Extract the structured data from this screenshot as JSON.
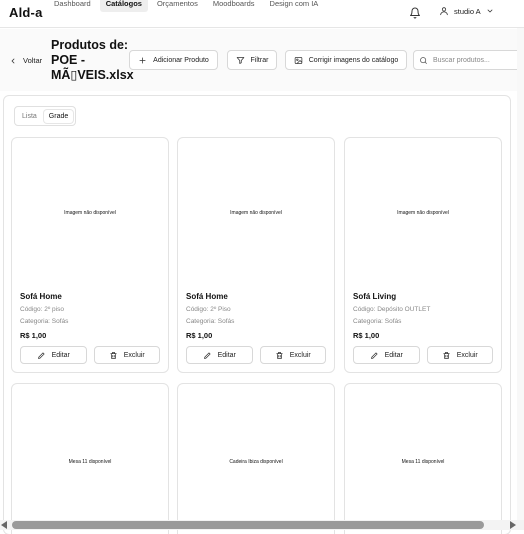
{
  "app": {
    "brand": "Ald-a"
  },
  "nav": {
    "links": [
      "Dashboard",
      "Catálogos",
      "Orçamentos",
      "Moodboards",
      "Design com IA"
    ],
    "active_index": 1
  },
  "user": {
    "name": "studio A"
  },
  "toolbar": {
    "back_label": "Voltar",
    "title": "Produtos de: POE - MÃ▯VEIS.xlsx",
    "add_label": "Adicionar Produto",
    "filter_label": "Filtrar",
    "fix_images_label": "Corrigir imagens do catálogo",
    "search_placeholder": "Buscar produtos..."
  },
  "view_toggle": {
    "options": [
      "Lista",
      "Grade"
    ],
    "active": "Grade"
  },
  "products": [
    {
      "image_text": "Imagem não disponível",
      "name": "Sofá Home",
      "code": "Código: 2º piso",
      "category": "Categoria: Sofás",
      "price": "R$ 1,00",
      "edit_label": "Editar",
      "delete_label": "Excluir"
    },
    {
      "image_text": "Imagem não disponível",
      "name": "Sofá Home",
      "code": "Código: 2º Piso",
      "category": "Categoria: Sofás",
      "price": "R$ 1,00",
      "edit_label": "Editar",
      "delete_label": "Excluir"
    },
    {
      "image_text": "Imagem não disponível",
      "name": "Sofá Living",
      "code": "Código: Depósito OUTLET",
      "category": "Categoria: Sofás",
      "price": "R$ 1,00",
      "edit_label": "Editar",
      "delete_label": "Excluir"
    },
    {
      "image_text": "Mesa 11 disponível"
    },
    {
      "image_text": "Cadeira Ibiza disponível"
    },
    {
      "image_text": "Mesa 11 disponível"
    }
  ]
}
